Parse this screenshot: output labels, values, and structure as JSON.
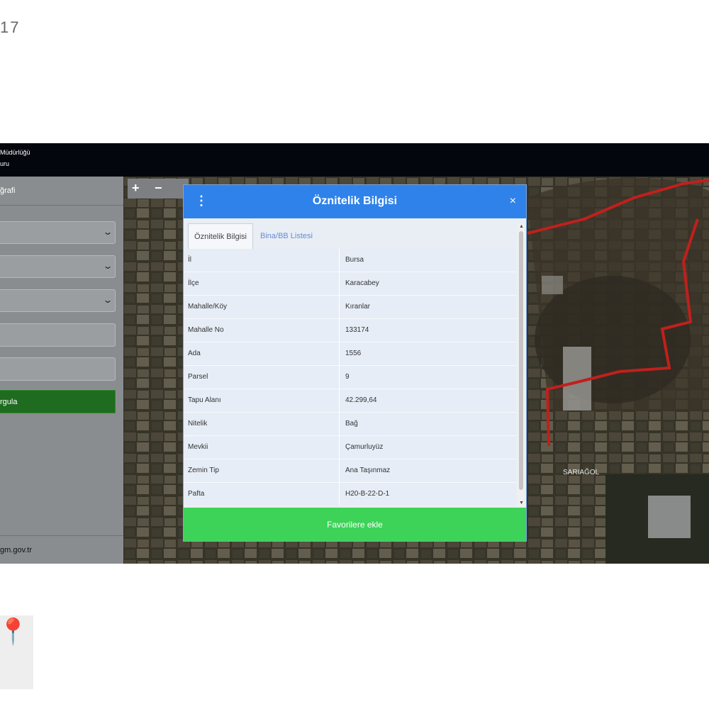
{
  "corner_number": "17",
  "topbar": {
    "line1": "Müdürlüğü",
    "line2": "uru"
  },
  "sidebar": {
    "header": "ğrafi",
    "go_button": "rgula",
    "footer": "gm.gov.tr"
  },
  "icons": {
    "menu": "kebab-menu-icon",
    "close": "close-icon",
    "zoom_in": "plus-icon",
    "zoom_out": "minus-icon",
    "chevron": "chevron-down-icon"
  },
  "map": {
    "zoom_in": "+",
    "zoom_out": "−",
    "labels": {
      "village": "SARIAĞOL"
    }
  },
  "dialog": {
    "title": "Öznitelik Bilgisi",
    "menu_glyph": "⋮",
    "close_glyph": "×",
    "tabs": [
      {
        "label": "Öznitelik Bilgisi",
        "active": true
      },
      {
        "label": "Bina/BB Listesi",
        "active": false
      }
    ],
    "rows": [
      {
        "key": "İl",
        "value": "Bursa"
      },
      {
        "key": "İlçe",
        "value": "Karacabey"
      },
      {
        "key": "Mahalle/Köy",
        "value": "Kıranlar"
      },
      {
        "key": "Mahalle No",
        "value": "133174"
      },
      {
        "key": "Ada",
        "value": "1556"
      },
      {
        "key": "Parsel",
        "value": "9"
      },
      {
        "key": "Tapu Alanı",
        "value": "42.299,64"
      },
      {
        "key": "Nitelik",
        "value": "Bağ"
      },
      {
        "key": "Mevkii",
        "value": "Çamurluyüz"
      },
      {
        "key": "Zemin Tip",
        "value": "Ana Taşınmaz"
      },
      {
        "key": "Pafta",
        "value": "H20-B-22-D-1"
      }
    ],
    "favorite_button": "Favorilere ekle"
  },
  "colors": {
    "accent_blue": "#2f82ea",
    "favorite_green": "#3dd358",
    "parcel_border": "#c0201c"
  }
}
